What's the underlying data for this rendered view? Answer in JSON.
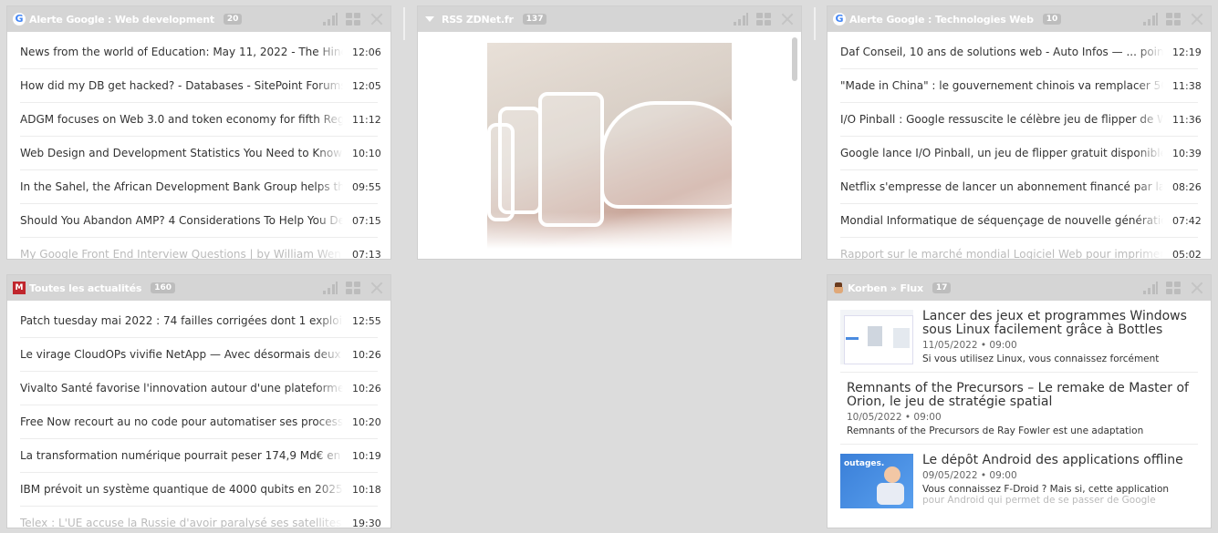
{
  "widgets": {
    "web_dev": {
      "title": "Alerte Google : Web development",
      "count": "20",
      "icon": "google-icon",
      "items": [
        {
          "title": "News from the world of Education: May 11, 2022 - The Hindu",
          "time": "12:06"
        },
        {
          "title": "How did my DB get hacked? - Databases - SitePoint Forums",
          "time": "12:05"
        },
        {
          "title": "ADGM focuses on Web 3.0 and token economy for fifth Regl",
          "time": "11:12"
        },
        {
          "title": "Web Design and Development Statistics You Need to Know in",
          "time": "10:10"
        },
        {
          "title": "In the Sahel, the African Development Bank Group helps the",
          "time": "09:55"
        },
        {
          "title": "Should You Abandon AMP? 4 Considerations To Help You De",
          "time": "07:15"
        },
        {
          "title": "My Google Front End Interview Questions | by William Wen",
          "time": "07:13"
        }
      ]
    },
    "zdnet": {
      "title": "RSS ZDNet.fr",
      "count": "137",
      "icon": "collapse-triangle-icon"
    },
    "tech_web": {
      "title": "Alerte Google : Technologies Web",
      "count": "10",
      "icon": "google-icon",
      "items": [
        {
          "title": "Daf Conseil, 10 ans de solutions web - Auto Infos — ... points",
          "time": "12:19"
        },
        {
          "title": "\"Made in China\" : le gouvernement chinois va remplacer 50 m",
          "time": "11:38"
        },
        {
          "title": "I/O Pinball : Google ressuscite le célèbre jeu de flipper de Wi",
          "time": "11:36"
        },
        {
          "title": "Google lance I/O Pinball, un jeu de flipper gratuit disponible",
          "time": "10:39"
        },
        {
          "title": "Netflix s'empresse de lancer un abonnement financé par la p",
          "time": "08:26"
        },
        {
          "title": "Mondial Informatique de séquençage de nouvelle génératio",
          "time": "07:42"
        },
        {
          "title": "Rapport sur le marché mondial Logiciel Web pour imprimer",
          "time": "05:02"
        }
      ]
    },
    "actus": {
      "title": "Toutes les actualités",
      "count": "160",
      "icon": "m-logo-icon",
      "items": [
        {
          "title": "Patch tuesday mai 2022 : 74 failles corrigées dont 1 exploitée",
          "time": "12:55"
        },
        {
          "title": "Le virage CloudOPs vivifie NetApp — Avec désormais deux c",
          "time": "10:26"
        },
        {
          "title": "Vivalto Santé favorise l'innovation autour d'une plateforme d",
          "time": "10:26"
        },
        {
          "title": "Free Now recourt au no code pour automatiser ses processus",
          "time": "10:20"
        },
        {
          "title": "La transformation numérique pourrait peser 174,9 Md€ en F",
          "time": "10:19"
        },
        {
          "title": "IBM prévoit un système quantique de 4000 qubits en 2025 —",
          "time": "10:18"
        },
        {
          "title": "Telex : L'UE accuse la Russie d'avoir paralysé ses satellites, La",
          "time": "19:30"
        }
      ]
    },
    "korben": {
      "title": "Korben » Flux",
      "count": "17",
      "icon": "korben-avatar-icon",
      "items": [
        {
          "title": "Lancer des jeux et programmes Windows sous Linux facilement grâce à Bottles",
          "date": "11/05/2022 • 09:00",
          "desc": "Si vous utilisez Linux, vous connaissez forcément",
          "desc2": "",
          "thumb": "app-screenshot"
        },
        {
          "title": "Remnants of the Precursors – Le remake de Master of Orion, le jeu de stratégie spatial",
          "date": "10/05/2022 • 09:00",
          "desc": "Remnants of the Precursors de Ray Fowler est une adaptation",
          "desc2": "",
          "thumb": ""
        },
        {
          "title": "Le dépôt Android des applications offline",
          "date": "09/05/2022 • 09:00",
          "desc": "Vous connaissez F-Droid ? Mais si, cette application",
          "desc2": "pour Android qui permet de se passer de Google",
          "thumb": "blue-illustration",
          "thumb_text": "outages."
        }
      ]
    }
  },
  "colors": {
    "header_bg": "#d5d5d5",
    "page_bg": "#dcdcdc",
    "m_logo": "#c0262d",
    "google_blue": "#4285f4"
  }
}
